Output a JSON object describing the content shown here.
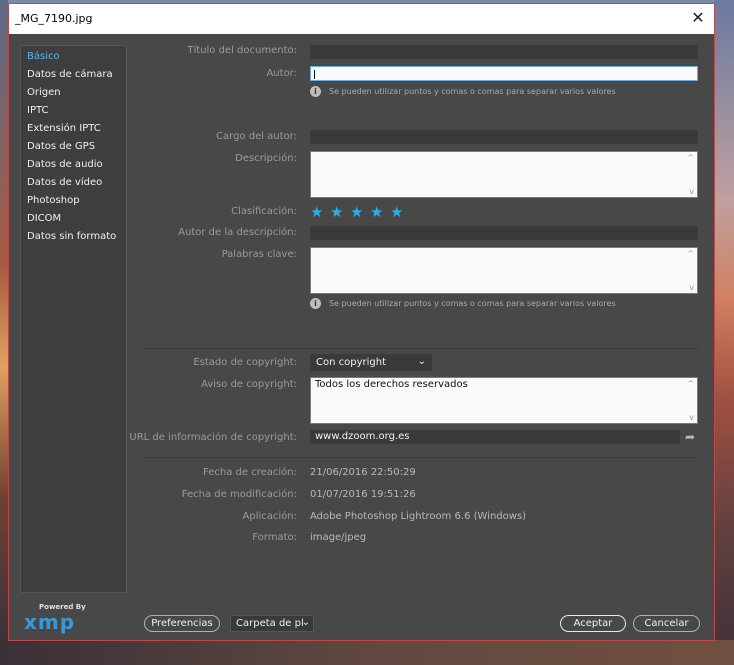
{
  "window": {
    "title": "_MG_7190.jpg",
    "close_glyph": "✕"
  },
  "sidebar": {
    "items": [
      {
        "label": "Básico",
        "active": true
      },
      {
        "label": "Datos de cámara"
      },
      {
        "label": "Origen"
      },
      {
        "label": "IPTC"
      },
      {
        "label": "Extensión IPTC"
      },
      {
        "label": "Datos de GPS"
      },
      {
        "label": "Datos de audio"
      },
      {
        "label": "Datos de vídeo"
      },
      {
        "label": "Photoshop"
      },
      {
        "label": "DICOM"
      },
      {
        "label": "Datos sin formato"
      }
    ]
  },
  "form": {
    "title_label": "Título del documento:",
    "title_value": "",
    "author_label": "Autor:",
    "author_value": "",
    "author_hint": "Se pueden utilizar puntos y comas o comas para separar varios valores",
    "author_position_label": "Cargo del autor:",
    "description_label": "Descripción:",
    "rating_label": "Clasificación:",
    "rating_stars": 5,
    "description_writer_label": "Autor de la descripción:",
    "keywords_label": "Palabras clave:",
    "keywords_hint": "Se pueden utilizar puntos y comas o comas para separar varios valores",
    "copyright_status_label": "Estado de copyright:",
    "copyright_status_value": "Con copyright",
    "copyright_notice_label": "Aviso de copyright:",
    "copyright_notice_value": "Todos los derechos reservados",
    "copyright_url_label": "URL de información de copyright:",
    "copyright_url_value": "www.dzoom.org.es",
    "created_label": "Fecha de creación:",
    "created_value": "21/06/2016 22:50:29",
    "modified_label": "Fecha de modificación:",
    "modified_value": "01/07/2016 19:51:26",
    "application_label": "Aplicación:",
    "application_value": "Adobe Photoshop Lightroom 6.6 (Windows)",
    "format_label": "Formato:",
    "format_value": "image/jpeg"
  },
  "branding": {
    "powered_by": "Powered By",
    "logo": "xmp"
  },
  "footer": {
    "preferences_label": "Preferencias",
    "folder_label": "Carpeta de pl",
    "accept_label": "Aceptar",
    "cancel_label": "Cancelar"
  },
  "icons": {
    "info": "i",
    "star": "★",
    "chevron": "⌄",
    "share": "➦",
    "scroll_up": "^",
    "scroll_down": "v"
  },
  "colors": {
    "accent": "#29b0ea",
    "active_nav": "#5ab4f0",
    "xmp_blue": "#3a98d8"
  }
}
